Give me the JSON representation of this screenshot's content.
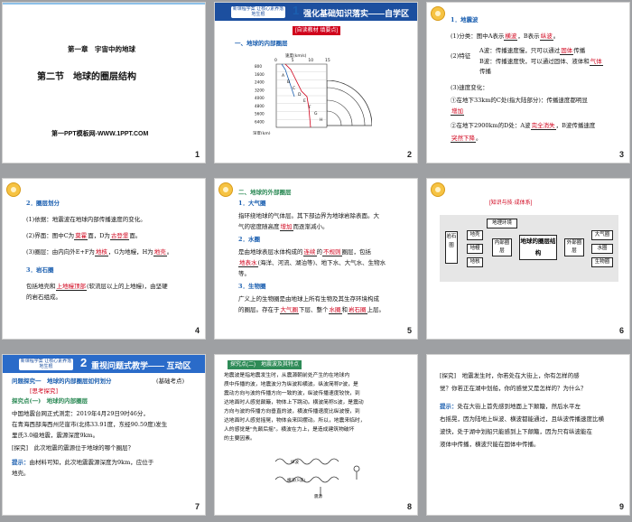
{
  "slides": [
    {
      "num": "1",
      "chapter": "第一章　宇宙中的地球",
      "section": "第二节　地球的圈层结构",
      "footer": "第一PPT模板网-WWW.1PPT.COM"
    },
    {
      "num": "2",
      "logo": "新课程学案 让核心素养落地生根",
      "banner": "强化基础知识落实——自学区",
      "tag": "[自读教材 填要点]",
      "heading": "一、地球的内部圈层",
      "axis_label": "速度(km/s)",
      "depth_label": "深度(km)",
      "ticks_x": [
        "0",
        "5",
        "10",
        "15"
      ],
      "ticks_y": [
        "800",
        "1600",
        "2400",
        "3200",
        "4000",
        "4800",
        "5600",
        "6400"
      ],
      "points": [
        "A",
        "B",
        "C",
        "D",
        "E",
        "F",
        "G",
        "H"
      ]
    },
    {
      "num": "3",
      "h1": "1．地震波",
      "l1": "(1)分类：图中A表示",
      "a1": "横波",
      "l1b": "，B表示",
      "a1b": "纵波",
      "l1c": "。",
      "l2": "(2)特征",
      "l2a": "A波：传播速度慢，只可以通过",
      "a2a": "固体",
      "l2a2": "传播",
      "l2b": "B波：传播速度快，可以通过固体、液体和",
      "a2b": "气体",
      "l2b2": "传播",
      "l3": "(3)速度变化：",
      "l4": "①在地下33km的C处(指大陆部分)：传播速度都明显",
      "a4": "增加",
      "l5": "②在地下2900km的D处：A波",
      "a5": "完全消失",
      "l5b": "，B波传播速度",
      "a5b": "突然下降",
      "l5c": "。"
    },
    {
      "num": "4",
      "h1": "2．圈层划分",
      "l1": "(1)依据：地震波在地球内部传播速度的变化。",
      "l2": "(2)界面：图中C为",
      "a2": "莫霍",
      "l2b": "面，D为",
      "a2b": "古登堡",
      "l2c": "面。",
      "l3": "(3)圈层：由内向外E+F为",
      "a3": "地核",
      "l3b": "，G为地幔，H为",
      "a3b": "地壳",
      "l3c": "。",
      "h2": "3．岩石圈",
      "l4": "包括地壳和",
      "a4": "上地幔顶部",
      "l4b": "(软流层以上的上地幔)，由坚硬",
      "l5": "的岩石组成。"
    },
    {
      "num": "5",
      "h0": "二、地球的外部圈层",
      "h1": "1．大气圈",
      "l1": "指环绕地球的气体层。其下部边界为地球岩除表面。大",
      "l2": "气的密度随高度",
      "a2": "增加",
      "l2b": "而逐渐减小。",
      "h2": "2．水圈",
      "l3": "是由地球表层水体构成的",
      "a3": "连续",
      "l3b": "的",
      "a3b": "不规则",
      "l3c": "圈层，包括",
      "a4": "地表水",
      "l4": "(海洋、河流、湖泊等)、地下水、大气水、生物水",
      "l5": "等。",
      "h3": "3．生物圈",
      "l6": "广义上的生物圈是由地球上所有生物及其生存环境构成",
      "l7": "的圈层。存在于",
      "a7": "大气圈",
      "l7b": "下层、整个",
      "a7b": "水圈",
      "l7c": "和",
      "a7c": "岩石圈",
      "l7d": "上层。"
    },
    {
      "num": "6",
      "tag": "[知识与技·成体系]",
      "center": "地球的圈层结构",
      "env": "地理环境",
      "left": "岩石圈",
      "inner": "内部圈层",
      "outer": "外部圈层",
      "crust": "地壳",
      "mantle": "地幔",
      "core": "地核",
      "air": "大气圈",
      "water": "水圈",
      "bio": "生物圈"
    },
    {
      "num": "7",
      "logo": "新课程学案 让核心素养落地生根",
      "banner": "重视问题式教学—— 互动区",
      "q": "问题探究一　地球的内部圈层如何划分",
      "q2": "(基础考点)",
      "tag": "[思考探究]",
      "inq": "探究点(一)　地球的内部圈层",
      "l1": "中国地震台网正式测定：2019年4月29日9时46分，",
      "l2": "在青海西部海西州茫崖市(北纬33.91度，东经90.59度)发生",
      "l3": "里氏3.0级地震，震源深度9km。",
      "l4": "[探究]　此次地震的震源位于地球的哪个圈层？",
      "l5": "提示：",
      "l5b": "由材料可知，此次地震震源深度为9km，应位于",
      "l6": "地壳。"
    },
    {
      "num": "8",
      "tag": "探究点(二)　地震波及其特点",
      "l1": "地震波是指地震发生时，从震源朝前处产生的在地球内",
      "l2": "质中传播的波，地震波分为纵波和横波。纵波简称P波，是",
      "l3": "震动方向与波的传播方向一致的波，纵波传播速度较快，到",
      "l4": "达地面时人感觉颠簸，物体上下跳动。横波简称S波，是震动",
      "l5": "方向与波的传播方向垂直的波，横波传播速度比纵波慢，到",
      "l6": "达地面时人感觉摇晃，物体会来回摆动。所以，地震来临时，",
      "l7": "人的感觉是\"先颠后摇\"。横波在力上，是造成建筑物破坏",
      "l8": "的主要因素。",
      "cap1": "纵波",
      "cap2": "横波(S波)",
      "cap3": "震源"
    },
    {
      "num": "9",
      "l1": "[探究]　地震发生时，你若处在大街上，你有怎样的感",
      "l2": "觉？你若正在湖中划船，你的感觉又是怎样的？为什么？",
      "l3": "提示：",
      "l3b": "处在大街上首先感到地面上下颠簸，然后水平左",
      "l4": "右摇晃，因为陆地上纵波、横波都能通过，且纵波传播速度比横",
      "l5": "波快，处于湖中划船只能感到上下颠簸，因为只有纵波能在",
      "l6": "液体中传播，横波只能在固体中传播。"
    }
  ],
  "colors": {
    "accent": "#1b5fb0",
    "answer": "#d0021b",
    "banner": "#1c4f9f",
    "green": "#2e8b57"
  }
}
